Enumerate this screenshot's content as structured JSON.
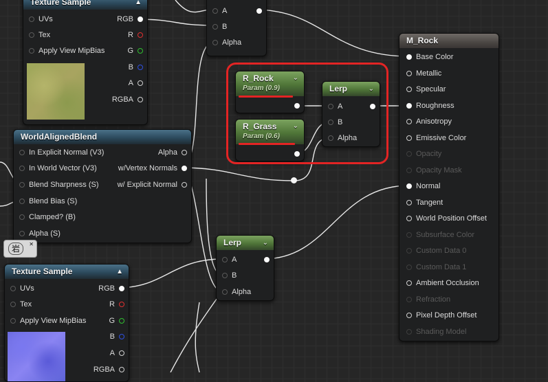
{
  "nodes": {
    "tex_top": {
      "title": "Texture Sample",
      "inputs": [
        "UVs",
        "Tex",
        "Apply View MipBias"
      ],
      "outputs": [
        "RGB",
        "R",
        "G",
        "B",
        "A",
        "RGBA"
      ]
    },
    "top_lerp": {
      "inputs": [
        "A",
        "B",
        "Alpha"
      ]
    },
    "wab": {
      "title": "WorldAlignedBlend",
      "inputs": [
        "In Explicit Normal (V3)",
        "In World Vector (V3)",
        "Blend Sharpness (S)",
        "Blend Bias (S)",
        "Clamped? (B)",
        "Alpha (S)"
      ],
      "outputs": [
        "Alpha",
        "w/Vertex Normals",
        "w/ Explicit Normal"
      ]
    },
    "r_rock": {
      "title": "R_Rock",
      "subtitle": "Param (0.9)"
    },
    "r_grass": {
      "title": "R_Grass",
      "subtitle": "Param (0.6)"
    },
    "lerp_mid": {
      "title": "Lerp",
      "inputs": [
        "A",
        "B",
        "Alpha"
      ]
    },
    "lerp_low": {
      "title": "Lerp",
      "inputs": [
        "A",
        "B",
        "Alpha"
      ]
    },
    "tex_bot": {
      "title": "Texture Sample",
      "inputs": [
        "UVs",
        "Tex",
        "Apply View MipBias"
      ],
      "outputs": [
        "RGB",
        "R",
        "G",
        "B",
        "A",
        "RGBA"
      ]
    },
    "m_rock": {
      "title": "M_Rock",
      "inputs": [
        "Base Color",
        "Metallic",
        "Specular",
        "Roughness",
        "Anisotropy",
        "Emissive Color",
        "Opacity",
        "Opacity Mask",
        "Normal",
        "Tangent",
        "World Position Offset",
        "Subsurface Color",
        "Custom Data 0",
        "Custom Data 1",
        "Ambient Occlusion",
        "Refraction",
        "Pixel Depth Offset",
        "Shading Model"
      ]
    }
  },
  "comment_bubble": {
    "text": "岩"
  },
  "colors": {
    "highlight": "#e32424",
    "header_texture": "#2c4a5d",
    "header_param": "#5f8a45",
    "header_lerp": "#4f7538",
    "header_material": "#4b4744",
    "pin_r": "#e03030",
    "pin_g": "#30c030",
    "pin_b": "#3050e0"
  },
  "icons": [
    "chevron-down-icon",
    "pin-dot",
    "close-icon"
  ]
}
